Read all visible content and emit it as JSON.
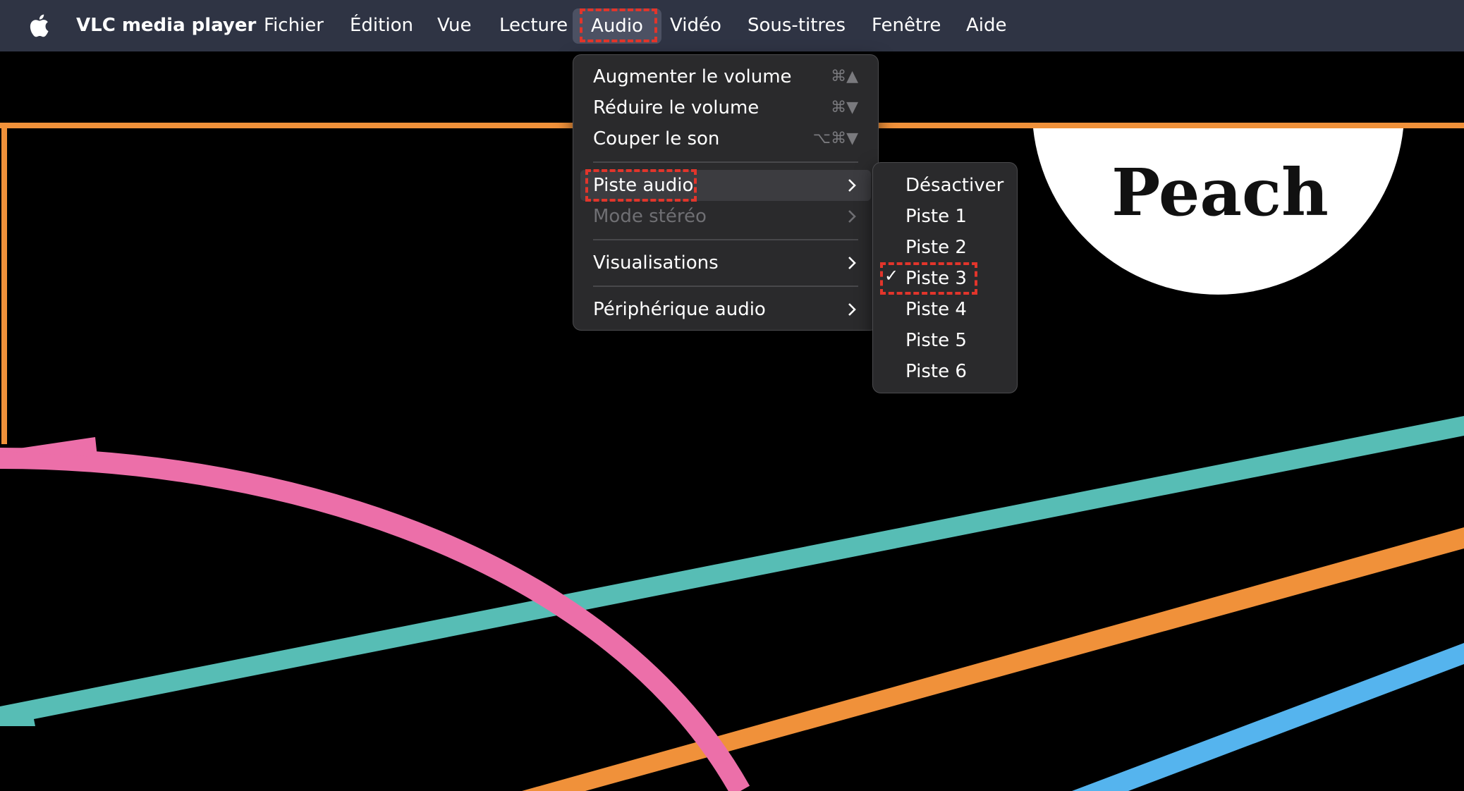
{
  "menubar": {
    "app_name": "VLC media player",
    "items": [
      "Fichier",
      "Édition",
      "Vue",
      "Lecture",
      "Audio",
      "Vidéo",
      "Sous-titres",
      "Fenêtre",
      "Aide"
    ],
    "active_item": "Audio"
  },
  "audio_menu": {
    "items": [
      {
        "label": "Augmenter le volume",
        "shortcut": "⌘▲"
      },
      {
        "label": "Réduire le volume",
        "shortcut": "⌘▼"
      },
      {
        "label": "Couper le son",
        "shortcut": "⌥⌘▼"
      },
      {
        "label": "Piste audio",
        "submenu": true,
        "highlighted": true
      },
      {
        "label": "Mode stéréo",
        "submenu": true,
        "disabled": true
      },
      {
        "label": "Visualisations",
        "submenu": true
      },
      {
        "label": "Périphérique audio",
        "submenu": true
      }
    ]
  },
  "track_submenu": {
    "items": [
      "Désactiver",
      "Piste 1",
      "Piste 2",
      "Piste 3",
      "Piste 4",
      "Piste 5",
      "Piste 6"
    ],
    "selected": "Piste 3",
    "check_mark": "✓"
  },
  "video": {
    "logo_text": "Peach"
  },
  "colors": {
    "menubar_bg": "#2f3444",
    "menu_bg": "#2a2a2c",
    "highlight_dash": "#e2352b",
    "orange": "#f0913a",
    "teal": "#57bdb5",
    "pink": "#ec6fa9",
    "blue": "#55b4ee"
  }
}
